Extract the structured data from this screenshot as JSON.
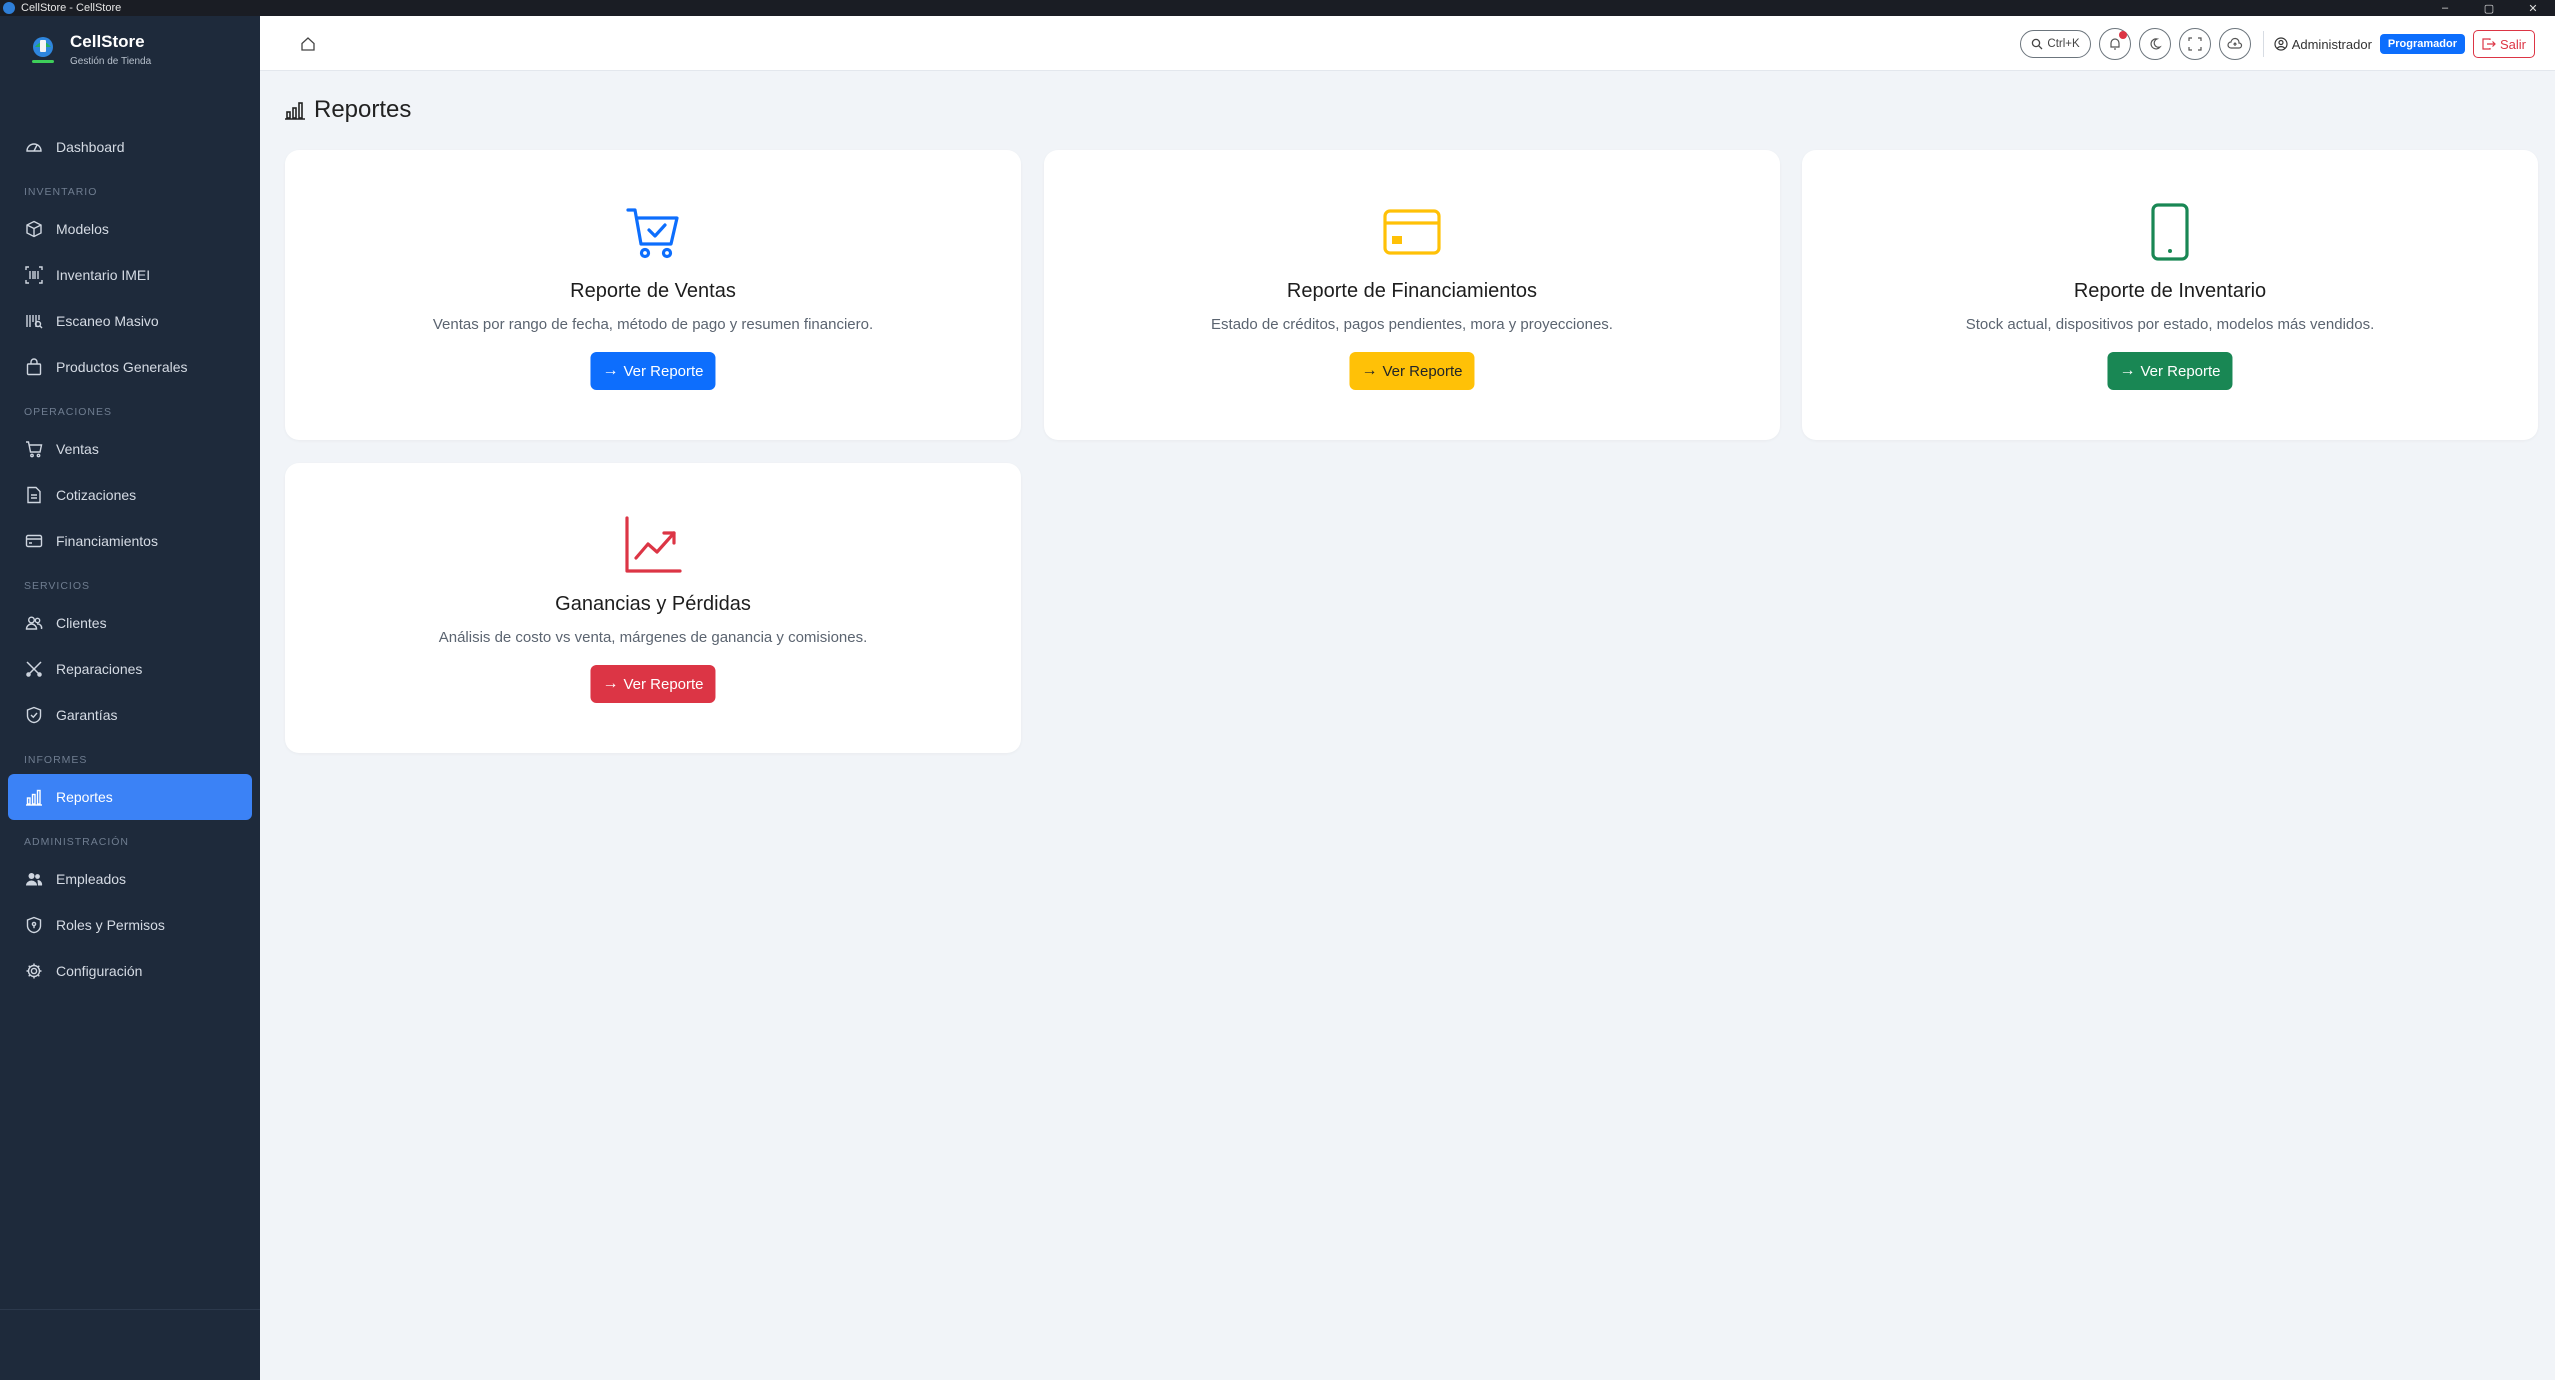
{
  "window": {
    "title": "CellStore - CellStore",
    "controls": [
      "–",
      "▢",
      "✕"
    ]
  },
  "brand": {
    "name": "CellStore",
    "subtitle": "Gestión de Tienda"
  },
  "sidebar": {
    "items": [
      {
        "type": "item",
        "label": "Dashboard",
        "icon": "gauge-icon"
      },
      {
        "type": "section",
        "label": "INVENTARIO"
      },
      {
        "type": "item",
        "label": "Modelos",
        "icon": "box-icon"
      },
      {
        "type": "item",
        "label": "Inventario IMEI",
        "icon": "barcode-icon"
      },
      {
        "type": "item",
        "label": "Escaneo Masivo",
        "icon": "scan-icon"
      },
      {
        "type": "item",
        "label": "Productos Generales",
        "icon": "bag-icon"
      },
      {
        "type": "section",
        "label": "OPERACIONES"
      },
      {
        "type": "item",
        "label": "Ventas",
        "icon": "cart-icon"
      },
      {
        "type": "item",
        "label": "Cotizaciones",
        "icon": "document-icon"
      },
      {
        "type": "item",
        "label": "Financiamientos",
        "icon": "credit-card-icon"
      },
      {
        "type": "section",
        "label": "SERVICIOS"
      },
      {
        "type": "item",
        "label": "Clientes",
        "icon": "people-icon"
      },
      {
        "type": "item",
        "label": "Reparaciones",
        "icon": "tools-icon"
      },
      {
        "type": "item",
        "label": "Garantías",
        "icon": "shield-check-icon"
      },
      {
        "type": "section",
        "label": "INFORMES"
      },
      {
        "type": "item",
        "label": "Reportes",
        "icon": "bar-chart-icon",
        "active": true
      },
      {
        "type": "section",
        "label": "ADMINISTRACIÓN"
      },
      {
        "type": "item",
        "label": "Empleados",
        "icon": "people-fill-icon"
      },
      {
        "type": "item",
        "label": "Roles y Permisos",
        "icon": "shield-lock-icon"
      },
      {
        "type": "item",
        "label": "Configuración",
        "icon": "gear-icon"
      }
    ]
  },
  "header": {
    "search_shortcut": "Ctrl+K",
    "user_name": "Administrador",
    "role_badge": "Programador",
    "logout_label": "Salir"
  },
  "page": {
    "title": "Reportes"
  },
  "cards": [
    {
      "title": "Reporte de Ventas",
      "description": "Ventas por rango de fecha, método de pago y resumen financiero.",
      "button": "Ver Reporte",
      "icon": "cart-check-icon",
      "color": "#0d6efd",
      "button_text_color": "#ffffff"
    },
    {
      "title": "Reporte de Financiamientos",
      "description": "Estado de créditos, pagos pendientes, mora y proyecciones.",
      "button": "Ver Reporte",
      "icon": "credit-card-icon",
      "color": "#ffc107",
      "button_text_color": "#212529"
    },
    {
      "title": "Reporte de Inventario",
      "description": "Stock actual, dispositivos por estado, modelos más vendidos.",
      "button": "Ver Reporte",
      "icon": "phone-icon",
      "color": "#198754",
      "button_text_color": "#ffffff"
    },
    {
      "title": "Ganancias y Pérdidas",
      "description": "Análisis de costo vs venta, márgenes de ganancia y comisiones.",
      "button": "Ver Reporte",
      "icon": "graph-up-icon",
      "color": "#dc3545",
      "button_text_color": "#ffffff"
    }
  ]
}
